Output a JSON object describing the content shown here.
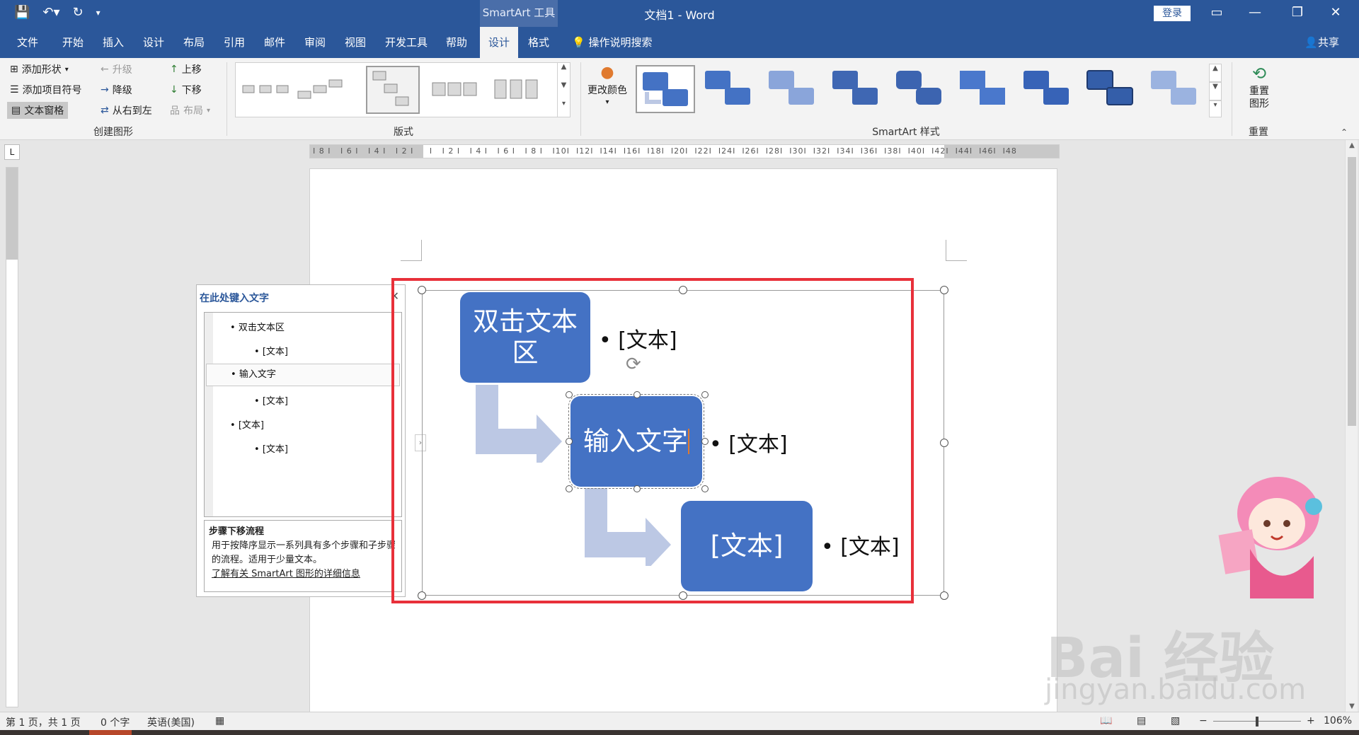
{
  "window": {
    "context_tool": "SmartArt 工具",
    "title": "文档1  -  Word",
    "login": "登录"
  },
  "tabs": [
    {
      "label": "文件"
    },
    {
      "label": "开始"
    },
    {
      "label": "插入"
    },
    {
      "label": "设计"
    },
    {
      "label": "布局"
    },
    {
      "label": "引用"
    },
    {
      "label": "邮件"
    },
    {
      "label": "审阅"
    },
    {
      "label": "视图"
    },
    {
      "label": "开发工具"
    },
    {
      "label": "帮助"
    },
    {
      "label": "设计"
    },
    {
      "label": "格式"
    }
  ],
  "tellme": "操作说明搜索",
  "share": "共享",
  "ribbon": {
    "create": {
      "add_shape": "添加形状",
      "add_bullet": "添加项目符号",
      "text_pane": "文本窗格",
      "promote": "升级",
      "demote": "降级",
      "rtl": "从右到左",
      "move_up": "上移",
      "move_down": "下移",
      "layout": "布局",
      "group_label": "创建图形"
    },
    "layouts_label": "版式",
    "change_colors": "更改颜色",
    "styles_label": "SmartArt 样式",
    "reset": {
      "button": "重置图形",
      "group_label": "重置"
    }
  },
  "text_pane": {
    "title": "在此处键入文字",
    "items": [
      {
        "text": "双击文本区"
      },
      {
        "text": "[文本]"
      },
      {
        "text": "输入文字"
      },
      {
        "text": "[文本]"
      },
      {
        "text": "[文本]"
      },
      {
        "text": "[文本]"
      }
    ],
    "desc_title": "步骤下移流程",
    "desc_body": "用于按降序显示一系列具有多个步骤和子步骤的流程。适用于少量文本。",
    "desc_link": "了解有关 SmartArt 图形的详细信息"
  },
  "smartart": {
    "box1": "双击文本区",
    "box2": "输入文字",
    "box3": "[文本]",
    "bullet1": "• [文本]",
    "bullet2": "• [文本]",
    "bullet3": "• [文本]"
  },
  "status": {
    "page": "第 1 页，共 1 页",
    "words": "0 个字",
    "lang": "英语(美国)",
    "zoom": "106%"
  },
  "watermark": {
    "line1": "Bai 经验",
    "line2": "jingyan.baidu.com"
  },
  "colors": {
    "brand": "#2b579a",
    "shape": "#4472c4",
    "arrow": "#bcc8e4",
    "highlight": "#e8303a"
  }
}
